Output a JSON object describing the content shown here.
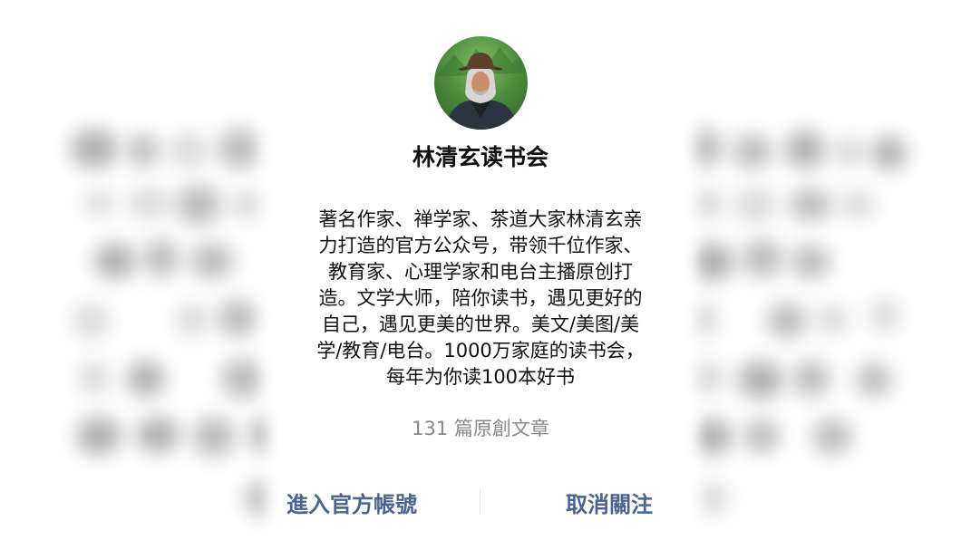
{
  "profile": {
    "name": "林清玄读书会",
    "description_lines": [
      "著名作家、禅学家、茶道大家林清玄亲",
      "力打造的官方公众号，带领千位作家、",
      "教育家、心理学家和电台主播原创打",
      "造。文学大师，陪你读书，遇见更好的",
      "自己，遇见更美的世界。美文/美图/美",
      "学/教育/电台。1000万家庭的读书会，",
      "每年为你读100本好书"
    ],
    "article_count": "131 篇原創文章"
  },
  "actions": {
    "enter_label": "進入官方帳號",
    "unfollow_label": "取消關注"
  },
  "colors": {
    "action_text": "#4a6390",
    "muted_text": "#888888"
  }
}
